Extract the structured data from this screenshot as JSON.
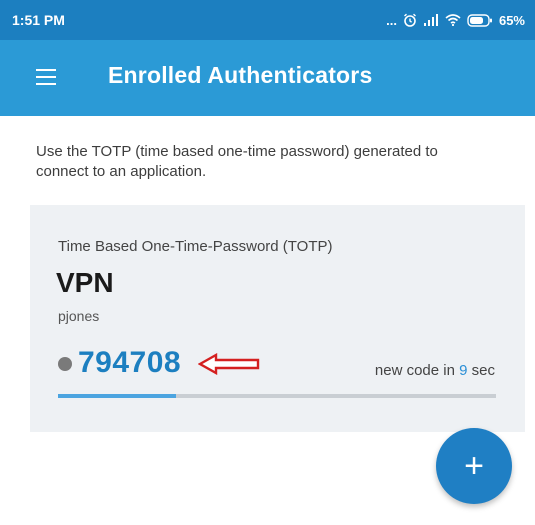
{
  "status_bar": {
    "time": "1:51 PM",
    "dots": "...",
    "battery_percent": "65%",
    "icons": [
      "alarm-icon",
      "signal-icon",
      "wifi-icon",
      "battery-icon"
    ]
  },
  "app_bar": {
    "title": "Enrolled Authenticators",
    "menu_icon": "hamburger-menu-icon",
    "background_color": "#2b9ad6"
  },
  "description": "Use the TOTP (time based one-time password) generated to connect to an application.",
  "authenticator": {
    "type_label": "Time Based One-Time-Password (TOTP)",
    "name": "VPN",
    "username": "pjones",
    "code": "794708",
    "countdown_prefix": "new code in ",
    "countdown_seconds": "9",
    "countdown_suffix": " sec",
    "progress_fraction": 0.27
  },
  "fab": {
    "label": "+",
    "icon": "add-icon"
  },
  "colors": {
    "accent": "#1c7fc0",
    "status_bar": "#1c7fc0",
    "annotation_arrow": "#d42020"
  }
}
